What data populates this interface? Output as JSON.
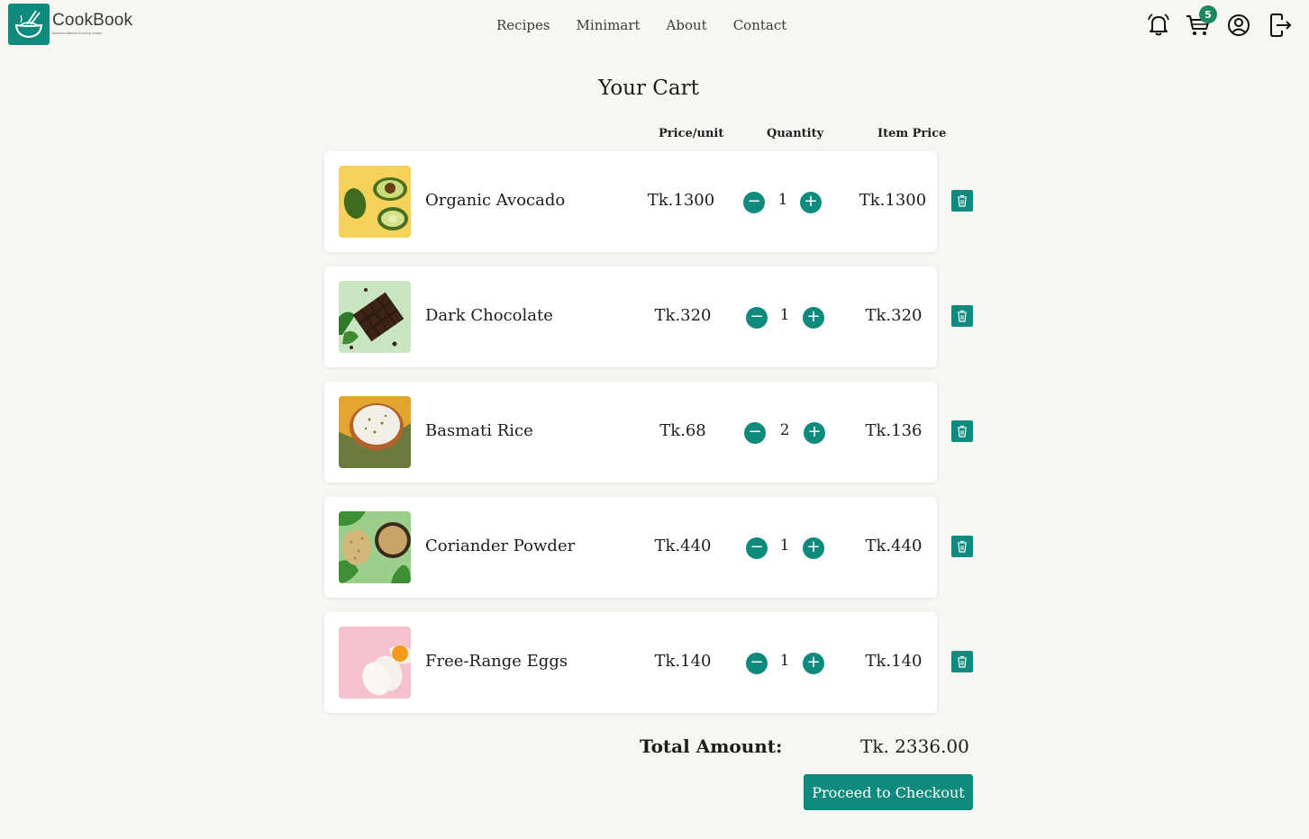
{
  "brand": {
    "name": "CookBook",
    "tagline": "discover flavors in every recipe"
  },
  "nav": [
    {
      "label": "Recipes"
    },
    {
      "label": "Minimart"
    },
    {
      "label": "About"
    },
    {
      "label": "Contact"
    }
  ],
  "header_icons": {
    "notification": "bell-icon",
    "cart": "cart-icon",
    "account": "user-circle-icon",
    "logout": "logout-icon",
    "cart_count": "5"
  },
  "page": {
    "title": "Your Cart"
  },
  "columns": {
    "price_unit": "Price/unit",
    "quantity": "Quantity",
    "item_price": "Item Price"
  },
  "items": [
    {
      "name": "Organic Avocado",
      "price": "Tk.1300",
      "qty": "1",
      "total": "Tk.1300",
      "image": "avocado"
    },
    {
      "name": "Dark Chocolate",
      "price": "Tk.320",
      "qty": "1",
      "total": "Tk.320",
      "image": "chocolate"
    },
    {
      "name": "Basmati Rice",
      "price": "Tk.68",
      "qty": "2",
      "total": "Tk.136",
      "image": "rice"
    },
    {
      "name": "Coriander Powder",
      "price": "Tk.440",
      "qty": "1",
      "total": "Tk.440",
      "image": "coriander"
    },
    {
      "name": "Free-Range Eggs",
      "price": "Tk.140",
      "qty": "1",
      "total": "Tk.140",
      "image": "eggs"
    }
  ],
  "summary": {
    "total_label": "Total Amount:",
    "total_value": "Tk. 2336.00",
    "checkout_label": "Proceed to Checkout"
  },
  "colors": {
    "accent": "#0f8a7c",
    "badge": "#1a8a5e",
    "background": "#f8f6f3"
  }
}
